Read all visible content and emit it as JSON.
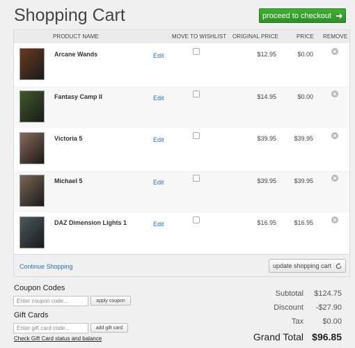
{
  "page": {
    "title": "Shopping Cart"
  },
  "checkout": {
    "label": "proceed to checkout"
  },
  "table": {
    "headers": {
      "product": "PRODUCT NAME",
      "wishlist": "MOVE TO WISHLIST",
      "original": "ORIGINAL PRICE",
      "price": "PRICE",
      "remove": "REMOVE"
    },
    "edit_label": "Edit",
    "rows": [
      {
        "name": "Arcane Wands",
        "original": "$12.95",
        "price": "$0.00",
        "thumb": "#6b3a20"
      },
      {
        "name": "Fantasy Camp II",
        "original": "$14.95",
        "price": "$0.00",
        "thumb": "#3f5a2a"
      },
      {
        "name": "Victoria 5",
        "original": "$39.95",
        "price": "$39.95",
        "thumb": "#8a6a5a"
      },
      {
        "name": "Michael 5",
        "original": "$39.95",
        "price": "$39.95",
        "thumb": "#7a6555"
      },
      {
        "name": "DAZ Dimension Lights 1",
        "original": "$16.95",
        "price": "$16.95",
        "thumb": "#4a5a60"
      }
    ]
  },
  "footer": {
    "continue": "Continue Shopping",
    "update": "update shopping cart"
  },
  "coupon": {
    "label": "Coupon Codes",
    "placeholder": "Enter coupon code...",
    "button": "apply coupon"
  },
  "gift": {
    "label": "Gift Cards",
    "placeholder": "Enter gift card code...",
    "button": "add gift card",
    "check_link": "Check Gift Card status and balance"
  },
  "totals": {
    "subtotal_label": "Subtotal",
    "subtotal": "$124.75",
    "discount_label": "Discount",
    "discount": "-$27.90",
    "tax_label": "Tax",
    "tax": "$0.00",
    "grand_label": "Grand Total",
    "grand": "$96.85"
  },
  "colors": {
    "checkout": "#2e9a27",
    "link": "#2a6fb3"
  }
}
